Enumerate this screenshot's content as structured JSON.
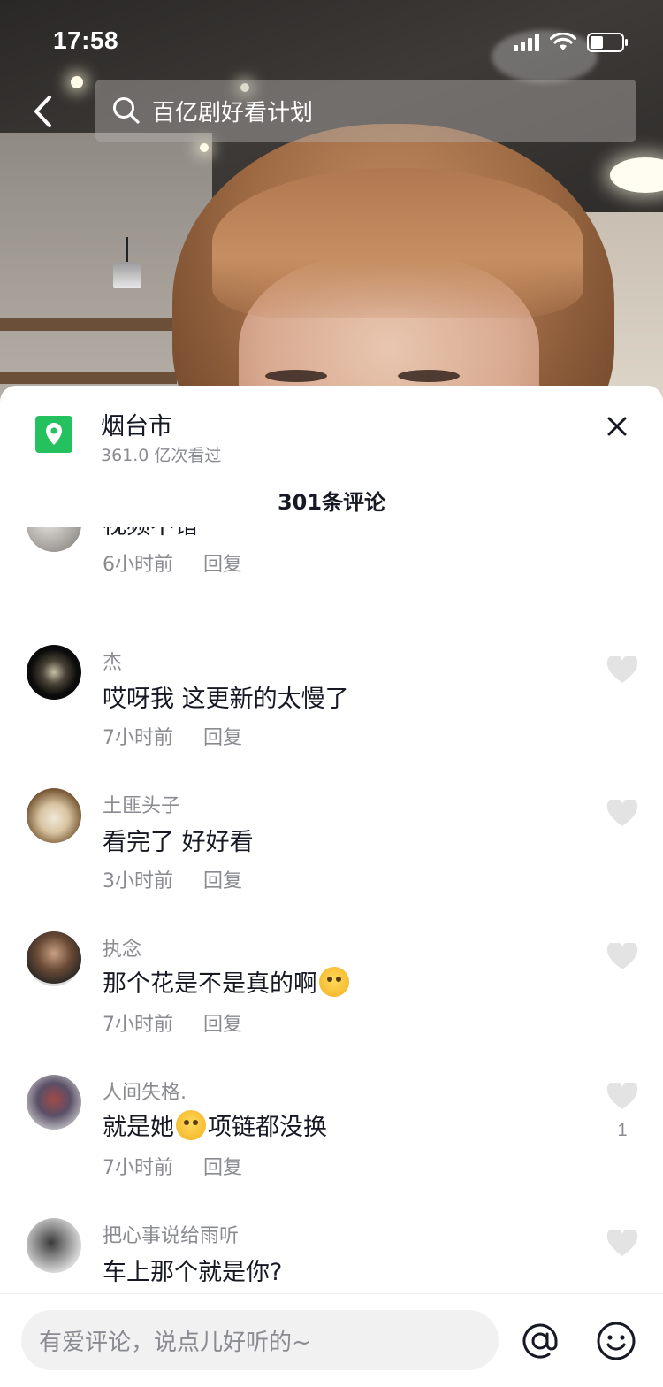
{
  "status_bar": {
    "time": "17:58"
  },
  "header": {
    "search_placeholder": "百亿剧好看计划"
  },
  "location": {
    "name": "烟台市",
    "views": "361.0 亿次看过"
  },
  "comment_count": "301条评论",
  "comments": [
    {
      "user": "",
      "text": "视频不错",
      "time": "6小时前",
      "reply": "回复",
      "likes": ""
    },
    {
      "user": "杰",
      "text": "哎呀我 这更新的太慢了",
      "time": "7小时前",
      "reply": "回复",
      "likes": ""
    },
    {
      "user": "土匪头子",
      "text": "看完了 好好看",
      "time": "3小时前",
      "reply": "回复",
      "likes": ""
    },
    {
      "user": "执念",
      "text_before": "那个花是不是真的啊",
      "text_after": "",
      "time": "7小时前",
      "reply": "回复",
      "likes": ""
    },
    {
      "user": "人间失格.",
      "text_before": "就是她",
      "text_after": "项链都没换",
      "time": "7小时前",
      "reply": "回复",
      "likes": "1"
    },
    {
      "user": "把心事说给雨听",
      "text": "车上那个就是你?",
      "time": "",
      "reply": "",
      "likes": ""
    }
  ],
  "input": {
    "placeholder": "有爱评论，说点儿好听的~"
  },
  "colors": {
    "text_primary": "#161823",
    "text_secondary": "#8a8b91",
    "location_green": "#25c15f"
  }
}
